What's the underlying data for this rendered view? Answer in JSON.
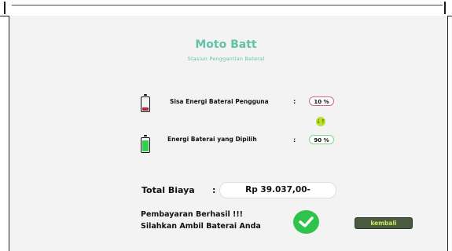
{
  "header": {
    "title": "Moto Batt",
    "subtitle": "Stasiun  Penggantian Bateral"
  },
  "current_battery": {
    "label": "Sisa Energi Baterai Pengguna",
    "colon": ":",
    "value": "10 %",
    "level": 0.1
  },
  "swap_icon": {
    "glyph": "↓↑"
  },
  "selected_battery": {
    "label": "Energi Baterai yang Dipilih",
    "colon": ":",
    "value": "90 %",
    "level": 0.9
  },
  "total": {
    "label": "Total Biaya",
    "colon": ":",
    "value": "Rp 39.037,00-"
  },
  "message": {
    "line1": "Pembayaran Berhasil !!!",
    "line2": "Silahkan Ambil Baterai Anda"
  },
  "back_button": {
    "label": "kembali"
  },
  "colors": {
    "accent": "#62c3a8",
    "low_battery": "#c0203a",
    "full_battery": "#2ed24a",
    "success": "#2fc24c",
    "button_bg": "#4a5a3e",
    "button_text": "#c8e85a"
  }
}
